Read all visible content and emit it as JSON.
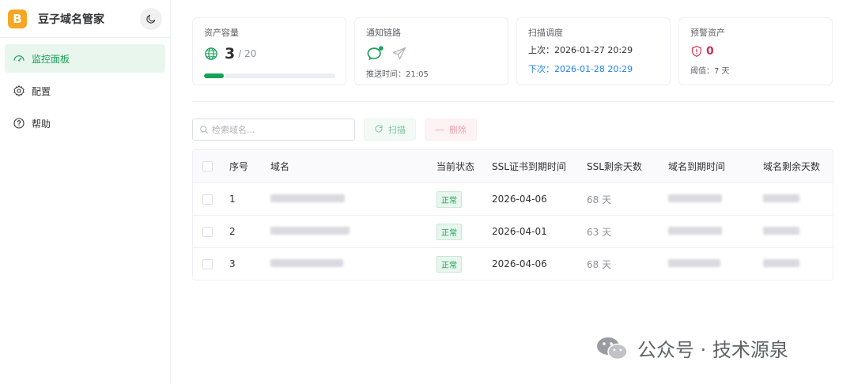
{
  "brand": {
    "logo_letter": "B",
    "name": "豆子域名管家"
  },
  "nav": [
    {
      "label": "监控面板",
      "icon": "dashboard-icon",
      "active": true
    },
    {
      "label": "配置",
      "icon": "gear-icon",
      "active": false
    },
    {
      "label": "帮助",
      "icon": "help-icon",
      "active": false
    }
  ],
  "cards": {
    "capacity": {
      "title": "资产容量",
      "used": "3",
      "total": "/ 20",
      "fill_percent": 15
    },
    "notify": {
      "title": "通知链路",
      "time_label": "推送时间：21:05"
    },
    "schedule": {
      "title": "扫描调度",
      "last": "上次：2026-01-27 20:29",
      "next": "下次：2026-01-28 20:29"
    },
    "warning": {
      "title": "预警资产",
      "count": "0",
      "threshold": "阈值：7 天"
    }
  },
  "toolbar": {
    "search_placeholder": "检索域名...",
    "scan_label": "扫描",
    "delete_label": "删除"
  },
  "table": {
    "headers": [
      "序号",
      "域名",
      "当前状态",
      "SSL证书到期时间",
      "SSL剩余天数",
      "域名到期时间",
      "域名剩余天数"
    ],
    "rows": [
      {
        "idx": "1",
        "status": "正常",
        "ssl_expiry": "2026-04-06",
        "ssl_days": "68 天"
      },
      {
        "idx": "2",
        "status": "正常",
        "ssl_expiry": "2026-04-01",
        "ssl_days": "63 天"
      },
      {
        "idx": "3",
        "status": "正常",
        "ssl_expiry": "2026-04-06",
        "ssl_days": "68 天"
      }
    ]
  },
  "watermark": {
    "text": "公众号 · 技术源泉"
  },
  "colors": {
    "primary": "#18a058",
    "link": "#2080f0",
    "danger": "#d03050",
    "logo": "#f5a623"
  }
}
